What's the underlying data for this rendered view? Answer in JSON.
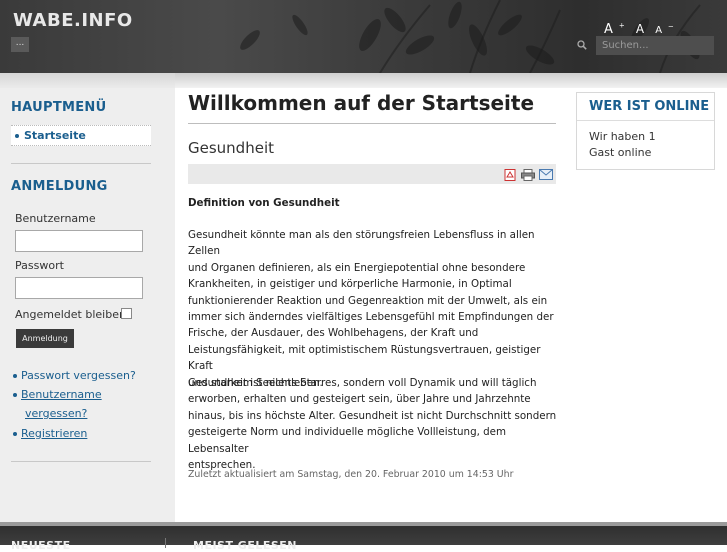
{
  "header": {
    "site_title": "WABE.INFO",
    "menu_button": "...",
    "font_size": {
      "bigger": "A",
      "reset": "A",
      "smaller": "A"
    },
    "search_placeholder": "Suchen..."
  },
  "sidebar": {
    "main_menu": {
      "title": "HAUPTMENÜ",
      "items": [
        {
          "label": "Startseite"
        }
      ]
    },
    "login": {
      "title": "ANMELDUNG",
      "username_label": "Benutzername",
      "password_label": "Passwort",
      "remember_label": "Angemeldet bleiben",
      "submit_label": "Anmeldung",
      "links": {
        "forgot_password": "Passwort vergessen?",
        "forgot_username_1": "Benutzername",
        "forgot_username_2": "vergessen?",
        "register": "Registrieren"
      }
    }
  },
  "main": {
    "page_heading": "Willkommen auf der Startseite",
    "article_title": "Gesundheit",
    "subheading": "Definition von Gesundheit",
    "paragraph1": [
      "Gesundheit könnte man als den störungsfreien Lebensfluss in allen Zellen",
      "und Organen definieren, als ein Energiepotential ohne besondere",
      "Krankheiten, in geistiger und körperliche Harmonie, in Optimal",
      "funktionierender Reaktion und Gegenreaktion mit der Umwelt, als ein",
      "immer sich änderndes vielfältiges Lebensgefühl mit Empfindungen der",
      "Frische, der Ausdauer, des Wohlbehagens, der Kraft und",
      "Leistungsfähigkeit, mit optimistischem Rüstungsvertrauen, geistiger Kraft",
      "und starkem Seelenleben."
    ],
    "paragraph2": [
      "Gesundheit ist nichts Starres, sondern voll Dynamik und will täglich",
      "erworben, erhalten und gesteigert sein, über Jahre und Jahrzehnte",
      "hinaus, bis ins höchste Alter. Gesundheit ist nicht Durchschnitt sondern",
      "gesteigerte Norm und individuelle mögliche Vollleistung, dem Lebensalter",
      "entsprechen."
    ],
    "modified": "Zuletzt aktualisiert am Samstag, den 20. Februar 2010 um 14:53 Uhr"
  },
  "right": {
    "whos_online_title": "WER IST ONLINE",
    "line1": "Wir haben 1",
    "line2": "Gast online"
  },
  "footer": {
    "col1_title": "NEUESTE",
    "col2_title": "MEIST GELESEN"
  }
}
